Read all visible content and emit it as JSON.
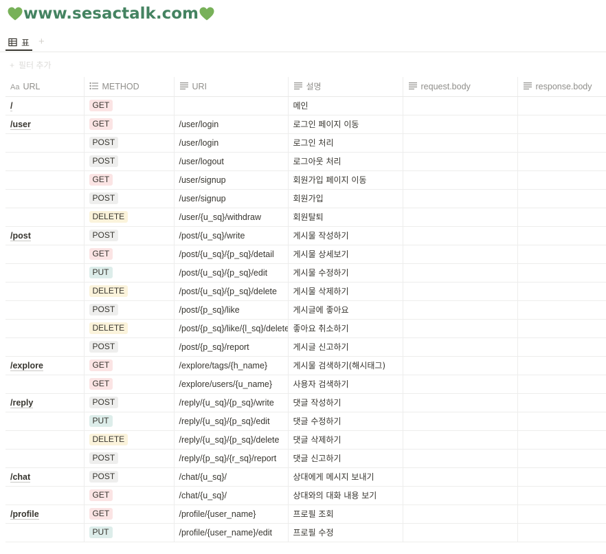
{
  "page_title": "www.sesactalk.com",
  "title_icon": "green-heart-icon",
  "accent_color": "#448361",
  "tab": {
    "label": "표",
    "icon": "table-icon"
  },
  "tab_add_label": "+",
  "filter_add_label": "필터 추가",
  "columns": [
    {
      "label": "URL",
      "icon": "title-aa-icon"
    },
    {
      "label": "METHOD",
      "icon": "multi-select-icon"
    },
    {
      "label": "URI",
      "icon": "text-icon"
    },
    {
      "label": "설명",
      "icon": "text-icon"
    },
    {
      "label": "request.body",
      "icon": "text-icon"
    },
    {
      "label": "response.body",
      "icon": "text-icon"
    }
  ],
  "method_colors": {
    "GET": "#fbe4e4",
    "POST": "#eeeeed",
    "PUT": "#ddedea",
    "DELETE": "#fbf3db"
  },
  "rows": [
    {
      "url": "/",
      "method": "GET",
      "uri": "",
      "desc": "메인",
      "req": "",
      "res": ""
    },
    {
      "url": "/user",
      "method": "GET",
      "uri": "/user/login",
      "desc": "로그인 페이지 이동",
      "req": "",
      "res": ""
    },
    {
      "url": "",
      "method": "POST",
      "uri": "/user/login",
      "desc": "로그인 처리",
      "req": "",
      "res": ""
    },
    {
      "url": "",
      "method": "POST",
      "uri": "/user/logout",
      "desc": "로그아웃 처리",
      "req": "",
      "res": ""
    },
    {
      "url": "",
      "method": "GET",
      "uri": "/user/signup",
      "desc": "회원가입 페이지 이동",
      "req": "",
      "res": ""
    },
    {
      "url": "",
      "method": "POST",
      "uri": "/user/signup",
      "desc": "회원가입",
      "req": "",
      "res": ""
    },
    {
      "url": "",
      "method": "DELETE",
      "uri": "/user/{u_sq}/withdraw",
      "desc": "회원탈퇴",
      "req": "",
      "res": ""
    },
    {
      "url": "/post",
      "method": "POST",
      "uri": "/post/{u_sq}/write",
      "desc": "게시물 작성하기",
      "req": "",
      "res": ""
    },
    {
      "url": "",
      "method": "GET",
      "uri": "/post/{u_sq}/{p_sq}/detail",
      "desc": "게시물 상세보기",
      "req": "",
      "res": ""
    },
    {
      "url": "",
      "method": "PUT",
      "uri": "/post/{u_sq}/{p_sq}/edit",
      "desc": "게시물 수정하기",
      "req": "",
      "res": ""
    },
    {
      "url": "",
      "method": "DELETE",
      "uri": "/post/{u_sq}/{p_sq}/delete",
      "desc": "게시물 삭제하기",
      "req": "",
      "res": ""
    },
    {
      "url": "",
      "method": "POST",
      "uri": "/post/{p_sq}/like",
      "desc": "게시글에 좋아요",
      "req": "",
      "res": ""
    },
    {
      "url": "",
      "method": "DELETE",
      "uri": "/post/{p_sq}/like/{l_sq}/delete",
      "desc": "좋아요 취소하기",
      "req": "",
      "res": ""
    },
    {
      "url": "",
      "method": "POST",
      "uri": "/post/{p_sq}/report",
      "desc": "게시글 신고하기",
      "req": "",
      "res": ""
    },
    {
      "url": "/explore",
      "method": "GET",
      "uri": "/explore/tags/{h_name}",
      "desc": "게시물 검색하기(해시태그)",
      "req": "",
      "res": ""
    },
    {
      "url": "",
      "method": "GET",
      "uri": "/explore/users/{u_name}",
      "desc": "사용자 검색하기",
      "req": "",
      "res": ""
    },
    {
      "url": "/reply",
      "method": "POST",
      "uri": "/reply/{u_sq}/{p_sq}/write",
      "desc": "댓글 작성하기",
      "req": "",
      "res": ""
    },
    {
      "url": "",
      "method": "PUT",
      "uri": "/reply/{u_sq}/{p_sq}/edit",
      "desc": "댓글 수정하기",
      "req": "",
      "res": ""
    },
    {
      "url": "",
      "method": "DELETE",
      "uri": "/reply/{u_sq}/{p_sq}/delete",
      "desc": "댓글 삭제하기",
      "req": "",
      "res": ""
    },
    {
      "url": "",
      "method": "POST",
      "uri": "/reply/{p_sq}/{r_sq}/report",
      "desc": "댓글 신고하기",
      "req": "",
      "res": ""
    },
    {
      "url": "/chat",
      "method": "POST",
      "uri": "/chat/{u_sq}/",
      "desc": "상대에게 메시지 보내기",
      "req": "",
      "res": ""
    },
    {
      "url": "",
      "method": "GET",
      "uri": "/chat/{u_sq}/",
      "desc": "상대와의 대화 내용 보기",
      "req": "",
      "res": ""
    },
    {
      "url": "/profile",
      "method": "GET",
      "uri": "/profile/{user_name}",
      "desc": "프로필 조회",
      "req": "",
      "res": ""
    },
    {
      "url": "",
      "method": "PUT",
      "uri": "/profile/{user_name}/edit",
      "desc": "프로필 수정",
      "req": "",
      "res": ""
    }
  ]
}
